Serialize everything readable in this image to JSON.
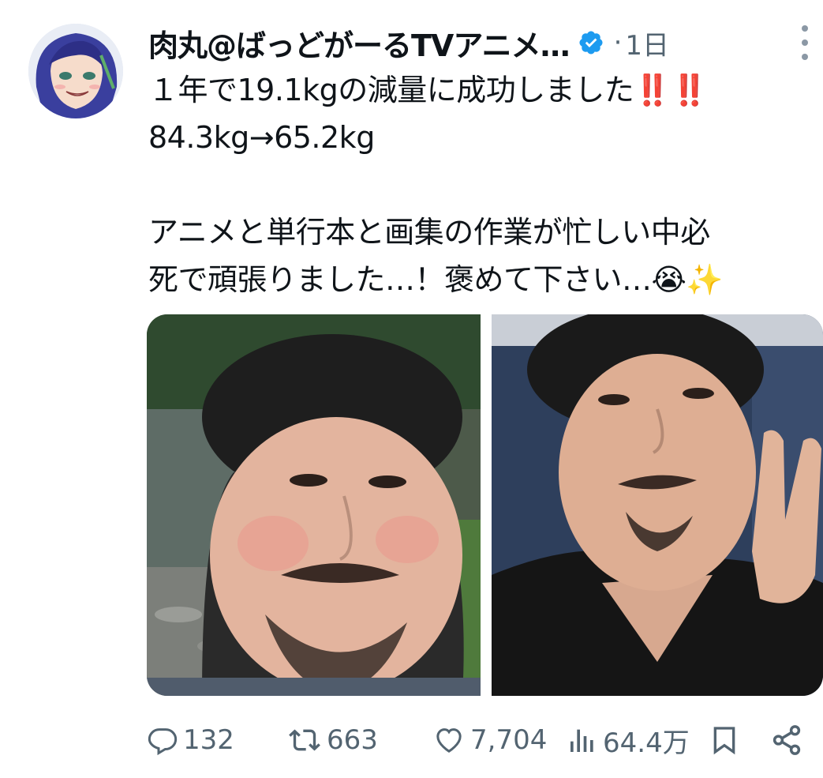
{
  "author": {
    "display_name": "肉丸@ばっどがーるTVアニメ…",
    "verified_icon": "verified-badge-icon",
    "separator": "·",
    "timestamp": "1日"
  },
  "tweet": {
    "lines": [
      "１年で19.1kgの減量に成功しました",
      "84.3kg→65.2kg",
      "アニメと単行本と画集の作業が忙しい中必",
      "死で頑張りました…！褒めて下さい…"
    ],
    "emoji_1": "‼️‼️",
    "emoji_2": "😭✨"
  },
  "media": {
    "photos": [
      {
        "icon": "before-photo"
      },
      {
        "icon": "after-photo"
      }
    ]
  },
  "actions": {
    "reply_count": "132",
    "retweet_count": "663",
    "like_count": "7,704",
    "views_count": "64.4万"
  },
  "colors": {
    "text_primary": "#0f1419",
    "text_secondary": "#536471",
    "verified_blue": "#1d9bf0",
    "emphasis_red": "#e0245e"
  }
}
